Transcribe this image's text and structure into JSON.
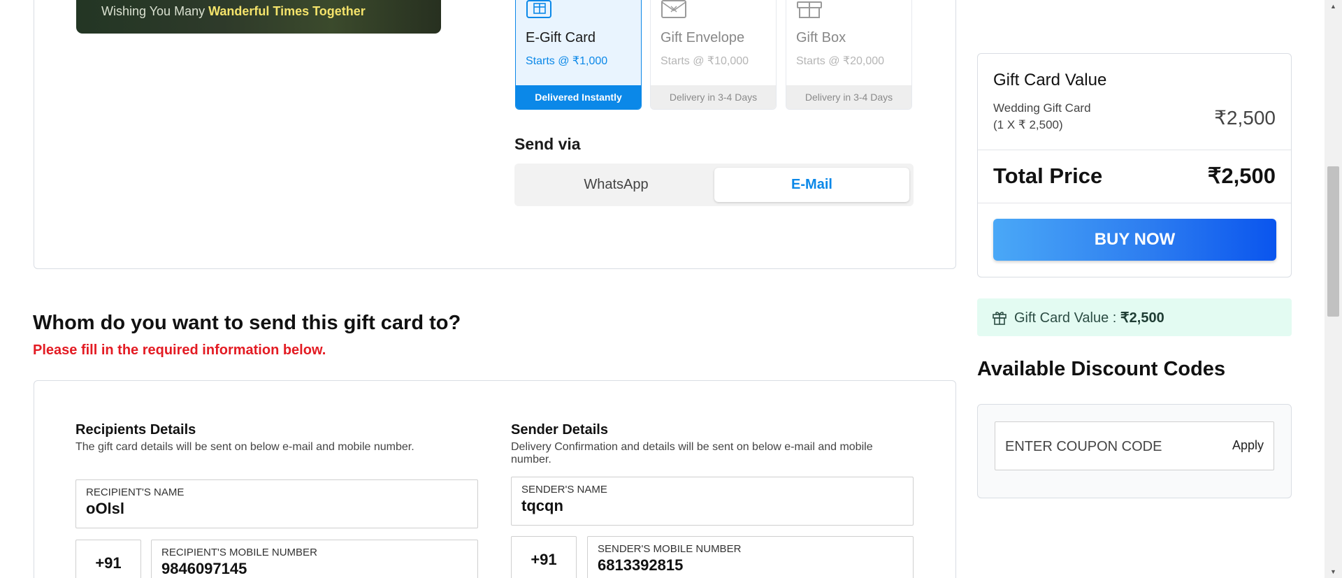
{
  "banner": {
    "text_prefix": "Wishing You Many ",
    "text_bold": "Wanderful Times Together"
  },
  "delivery_options": [
    {
      "title": "E-Gift Card",
      "price": "Starts @ ₹1,000",
      "delivery": "Delivered Instantly",
      "selected": true,
      "icon": "egift-card-icon"
    },
    {
      "title": "Gift Envelope",
      "price": "Starts @ ₹10,000",
      "delivery": "Delivery in 3-4 Days",
      "selected": false,
      "icon": "gift-envelope-icon"
    },
    {
      "title": "Gift Box",
      "price": "Starts @ ₹20,000",
      "delivery": "Delivery in 3-4 Days",
      "selected": false,
      "icon": "gift-box-icon"
    }
  ],
  "send_via": {
    "label": "Send via",
    "options": [
      "WhatsApp",
      "E-Mail"
    ],
    "selected": "E-Mail"
  },
  "recipient_section": {
    "heading": "Whom do you want to send this gift card to?",
    "required_msg": "Please fill in the required information below."
  },
  "recipient": {
    "title": "Recipients Details",
    "subtitle": "The gift card details will be sent on below e-mail and mobile number.",
    "name_label": "RECIPIENT'S NAME",
    "name_value": "oOlsl",
    "country_code": "+91",
    "mobile_label": "RECIPIENT'S MOBILE NUMBER",
    "mobile_value": "9846097145"
  },
  "sender": {
    "title": "Sender Details",
    "subtitle_line1": "Delivery Confirmation and details will be sent on below e-mail and mobile",
    "subtitle_line2": "number.",
    "name_label": "SENDER'S NAME",
    "name_value": "tqcqn",
    "country_code": "+91",
    "mobile_label": "SENDER'S MOBILE NUMBER",
    "mobile_value": "6813392815"
  },
  "summary": {
    "title": "Gift Card Value",
    "item_name": "Wedding Gift Card",
    "item_qty": "(1 X ₹ 2,500)",
    "item_amount": "₹2,500",
    "total_label": "Total Price",
    "total_amount": "₹2,500",
    "buy_label": "BUY NOW"
  },
  "value_pill": {
    "label": "Gift Card Value : ",
    "value": "₹2,500"
  },
  "discount": {
    "title": "Available Discount Codes",
    "placeholder": "ENTER COUPON CODE",
    "apply_label": "Apply"
  },
  "colors": {
    "accent": "#0b88e8",
    "error": "#e31b23",
    "pill_bg": "#e3fbf2"
  }
}
